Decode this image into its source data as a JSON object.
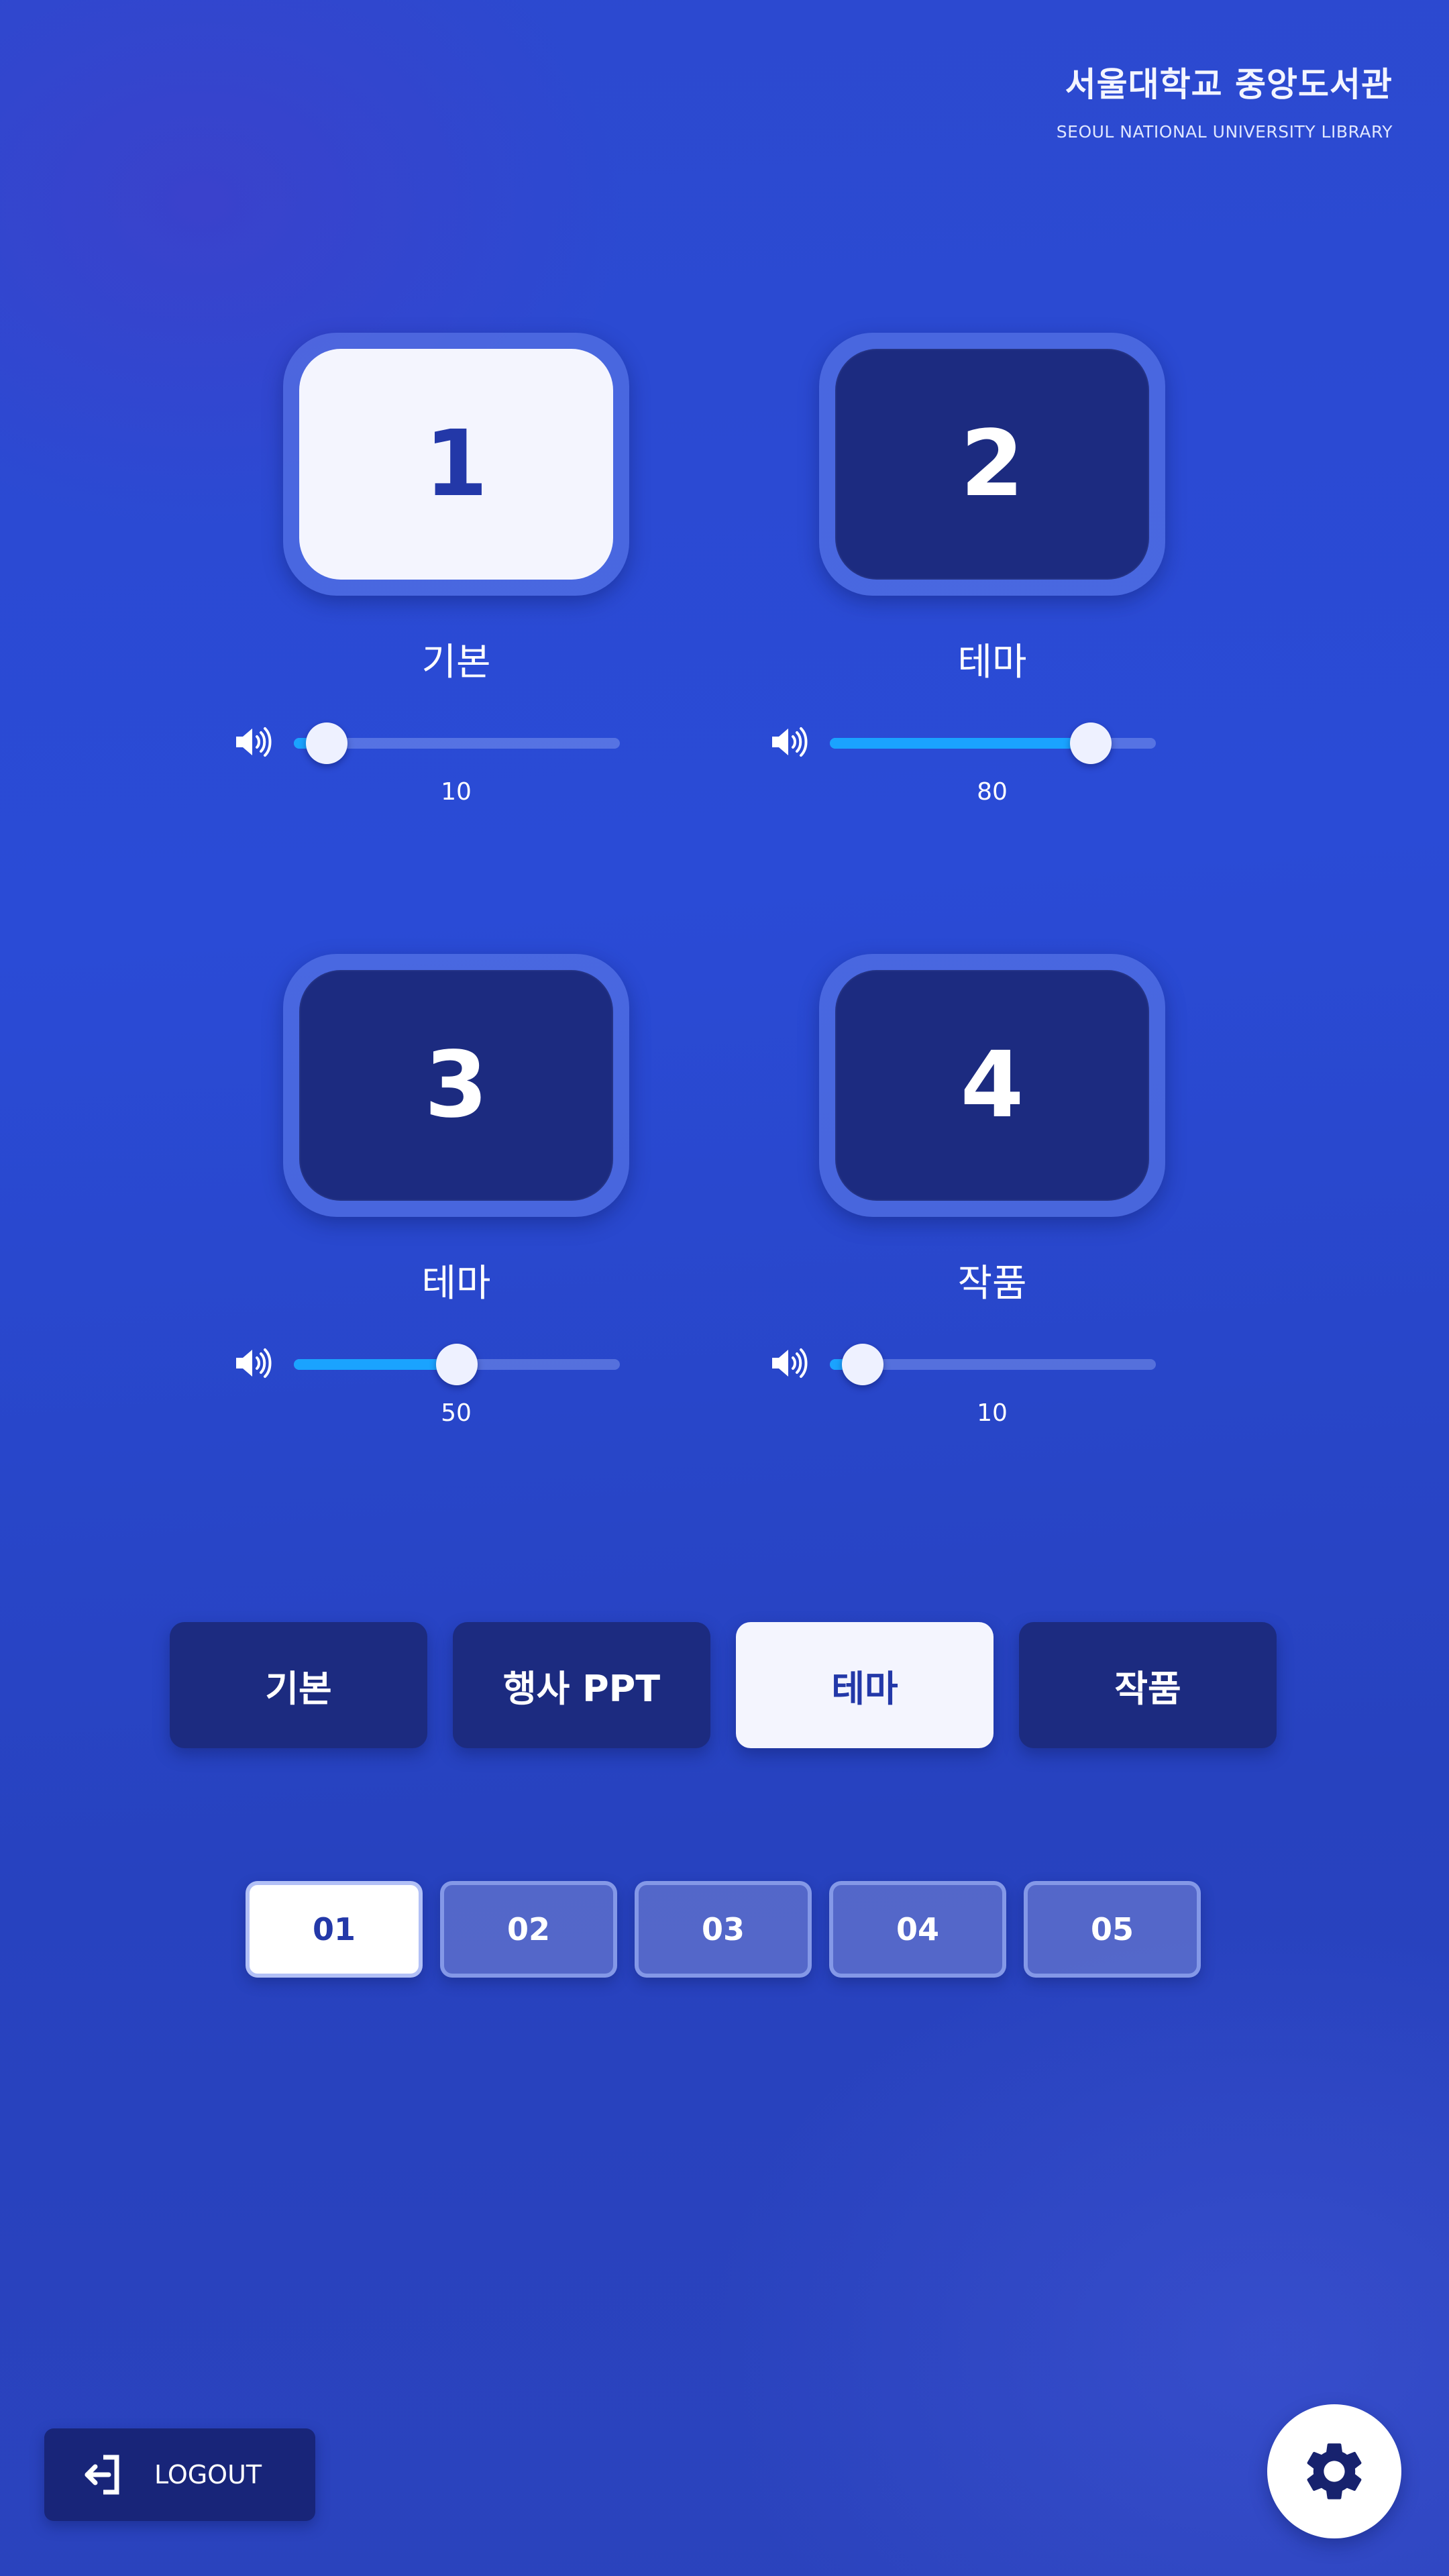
{
  "header": {
    "title": "서울대학교 중앙도서관",
    "subtitle": "SEOUL NATIONAL UNIVERSITY LIBRARY"
  },
  "displays": [
    {
      "number": "1",
      "label": "기본",
      "volume": 10,
      "volume_text": "10",
      "active": true
    },
    {
      "number": "2",
      "label": "테마",
      "volume": 80,
      "volume_text": "80",
      "active": false
    },
    {
      "number": "3",
      "label": "테마",
      "volume": 50,
      "volume_text": "50",
      "active": false
    },
    {
      "number": "4",
      "label": "작품",
      "volume": 10,
      "volume_text": "10",
      "active": false
    }
  ],
  "modes": [
    {
      "label": "기본",
      "active": false
    },
    {
      "label": "행사 PPT",
      "active": false
    },
    {
      "label": "테마",
      "active": true
    },
    {
      "label": "작품",
      "active": false
    }
  ],
  "pages": [
    {
      "label": "01",
      "active": true
    },
    {
      "label": "02",
      "active": false
    },
    {
      "label": "03",
      "active": false
    },
    {
      "label": "04",
      "active": false
    },
    {
      "label": "05",
      "active": false
    }
  ],
  "footer": {
    "logout_label": "LOGOUT",
    "logout_icon": "logout-icon",
    "settings_icon": "gear-icon"
  },
  "colors": {
    "accent_fill": "#1aa3ff",
    "tile_dark": "#1c2b80",
    "tile_active": "#f4f5fe",
    "active_text": "#2338a8"
  }
}
